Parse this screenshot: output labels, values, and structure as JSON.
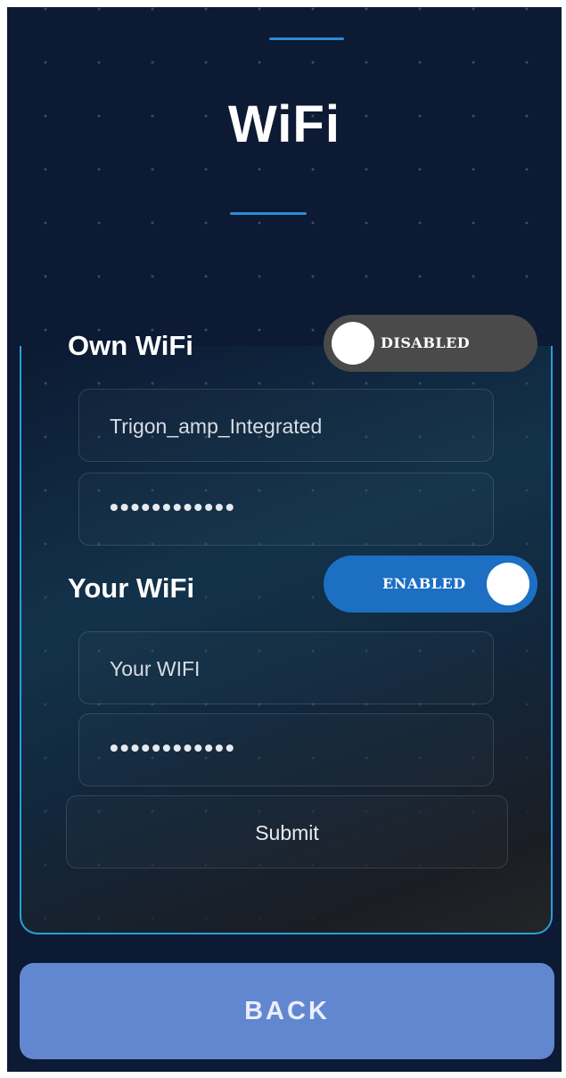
{
  "header": {
    "title": "WiFi"
  },
  "own_wifi": {
    "label": "Own WiFi",
    "toggle_state": "DISABLED",
    "ssid_value": "Trigon_amp_Integrated",
    "password_masked": "••••••••••••"
  },
  "your_wifi": {
    "label": "Your WiFi",
    "toggle_state": "ENABLED",
    "ssid_placeholder": "Your WIFI",
    "password_masked": "••••••••••••"
  },
  "actions": {
    "submit_label": "Submit",
    "back_label": "BACK"
  },
  "colors": {
    "background": "#0c1a33",
    "accent": "#2d8bd6",
    "toggle_enabled": "#1c6fc2",
    "toggle_disabled": "#4a4a4a",
    "back_button": "#6187d1"
  }
}
